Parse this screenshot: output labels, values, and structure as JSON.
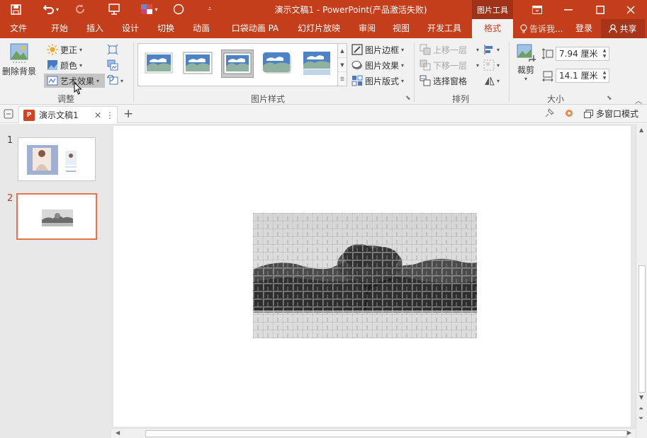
{
  "window": {
    "title": "演示文稿1 - PowerPoint(产品激活失败)",
    "context_tab_label": "图片工具"
  },
  "tabs": [
    "文件",
    "开始",
    "插入",
    "设计",
    "切换",
    "动画",
    "口袋动画 PA",
    "幻灯片放映",
    "审阅",
    "视图",
    "开发工具",
    "格式"
  ],
  "active_tab": "格式",
  "tell_me": "告诉我...",
  "login": "登录",
  "share": "共享",
  "ribbon": {
    "adjust": {
      "remove_background": "删除背景",
      "corrections": "更正",
      "color": "颜色",
      "artistic_effects": "艺术效果",
      "label": "调整"
    },
    "picture_styles": {
      "border": "图片边框",
      "effects": "图片效果",
      "layout": "图片版式",
      "label": "图片样式"
    },
    "arrange": {
      "bring_forward": "上移一层",
      "send_backward": "下移一层",
      "selection_pane": "选择窗格",
      "label": "排列"
    },
    "size": {
      "crop": "裁剪",
      "height": "7.94 厘米",
      "width": "14.1 厘米",
      "label": "大小"
    }
  },
  "document_tab": {
    "name": "演示文稿1",
    "multi_window_mode": "多窗口模式"
  },
  "slides": {
    "numbers": [
      "1",
      "2"
    ],
    "selected": 2
  },
  "colors": {
    "brand": "#c43e1c",
    "selection": "#e8734f"
  }
}
